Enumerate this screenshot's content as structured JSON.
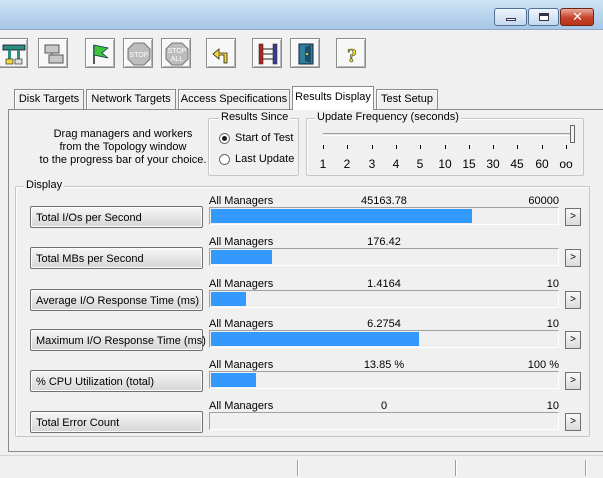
{
  "tabs": [
    {
      "label": "Disk Targets"
    },
    {
      "label": "Network Targets"
    },
    {
      "label": "Access Specifications"
    },
    {
      "label": "Results Display",
      "active": true
    },
    {
      "label": "Test Setup"
    }
  ],
  "hint_lines": [
    "Drag managers and workers",
    "from the Topology window",
    "to the progress bar of your choice."
  ],
  "results_since": {
    "title": "Results Since",
    "options": [
      {
        "label": "Start of Test",
        "selected": true
      },
      {
        "label": "Last Update",
        "selected": false
      }
    ]
  },
  "update_frequency": {
    "title": "Update Frequency (seconds)",
    "ticks": [
      "1",
      "2",
      "3",
      "4",
      "5",
      "10",
      "15",
      "30",
      "45",
      "60",
      "oo"
    ],
    "selected": "oo"
  },
  "display": {
    "title": "Display",
    "rows": [
      {
        "button": "Total I/Os per Second",
        "manager": "All Managers",
        "value": "45163.78",
        "max": "60000",
        "fill": 0.753
      },
      {
        "button": "Total MBs per Second",
        "manager": "All Managers",
        "value": "176.42",
        "max": "",
        "fill": 0.177
      },
      {
        "button": "Average I/O Response Time (ms)",
        "manager": "All Managers",
        "value": "1.4164",
        "max": "10",
        "fill": 0.1
      },
      {
        "button": "Maximum I/O Response Time (ms)",
        "manager": "All Managers",
        "value": "6.2754",
        "max": "10",
        "fill": 0.6
      },
      {
        "button": "% CPU Utilization (total)",
        "manager": "All Managers",
        "value": "13.85 %",
        "max": "100 %",
        "fill": 0.13
      },
      {
        "button": "Total Error Count",
        "manager": "All Managers",
        "value": "0",
        "max": "10",
        "fill": 0.0
      }
    ]
  },
  "toolbar_icons": [
    "topology-icon",
    "disk-worker-icon",
    "start-test-icon",
    "stop-icon",
    "stop-all-icon",
    "reset-icon",
    "network-icon",
    "exit-icon",
    "help-icon"
  ],
  "toolbar_text": {
    "stop": "STOP",
    "stop_all_top": "STOP",
    "stop_all_bottom": "ALL",
    "help": "?"
  },
  "arrow_label": ">",
  "colors": {
    "bar": "#3399ff",
    "titlebar": "#b9d3ee",
    "close": "#c7422b"
  }
}
